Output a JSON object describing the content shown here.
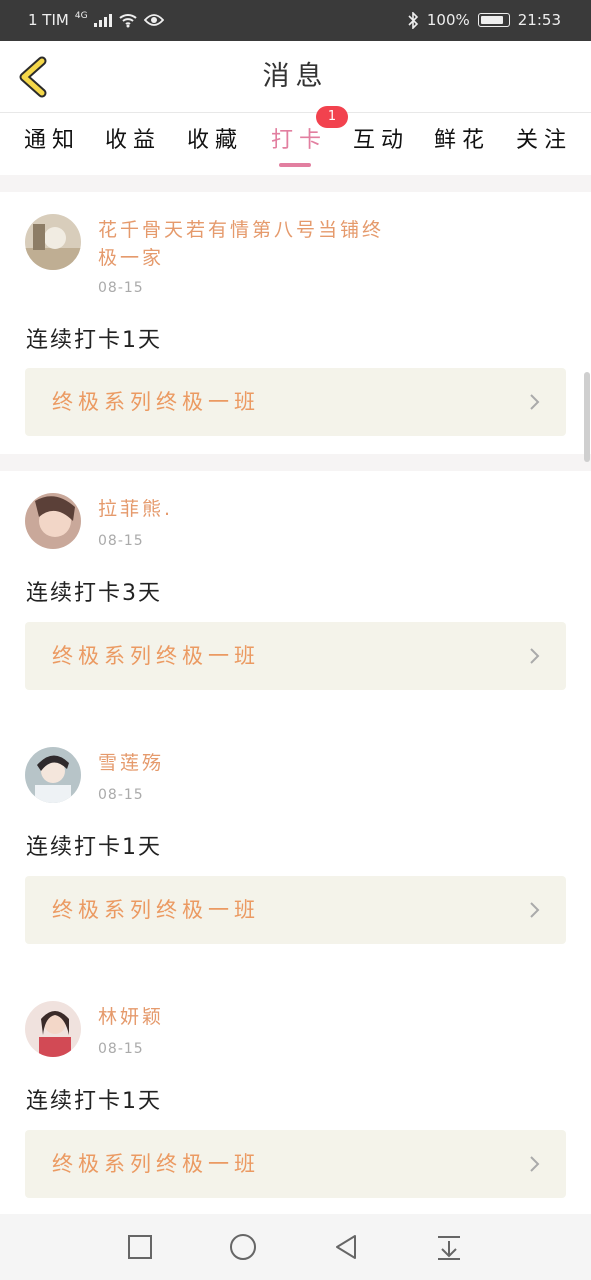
{
  "status_bar": {
    "carrier": "1 TIM",
    "network": "4G",
    "battery": "100%",
    "time": "21:53"
  },
  "header": {
    "title": "消息",
    "back_icon": "chevron-left-icon",
    "accent_color": "#f5d84a"
  },
  "tabs": [
    {
      "label": "通知",
      "active": false
    },
    {
      "label": "收益",
      "active": false
    },
    {
      "label": "收藏",
      "active": false
    },
    {
      "label": "打卡",
      "active": true,
      "badge": "1"
    },
    {
      "label": "互动",
      "active": false
    },
    {
      "label": "鲜花",
      "active": false
    },
    {
      "label": "关注",
      "active": false
    }
  ],
  "colors": {
    "active_tab": "#e27fa0",
    "badge": "#f2424e",
    "name": "#e59a6c",
    "link_text": "#eb9a62",
    "link_bg": "#f4f3ea"
  },
  "posts": [
    {
      "name": "花千骨天若有情第八号当铺终极一家",
      "date": "08-15",
      "text": "连续打卡1天",
      "link": "终极系列终极一班"
    },
    {
      "name": "拉菲熊.",
      "date": "08-15",
      "text": "连续打卡3天",
      "link": "终极系列终极一班"
    },
    {
      "name": "雪莲殇",
      "date": "08-15",
      "text": "连续打卡1天",
      "link": "终极系列终极一班"
    },
    {
      "name": "林妍颖",
      "date": "08-15",
      "text": "连续打卡1天",
      "link": "终极系列终极一班"
    }
  ],
  "nav_bar": {
    "icons": [
      "square-icon",
      "circle-icon",
      "back-triangle-icon",
      "notification-pull-icon"
    ]
  }
}
